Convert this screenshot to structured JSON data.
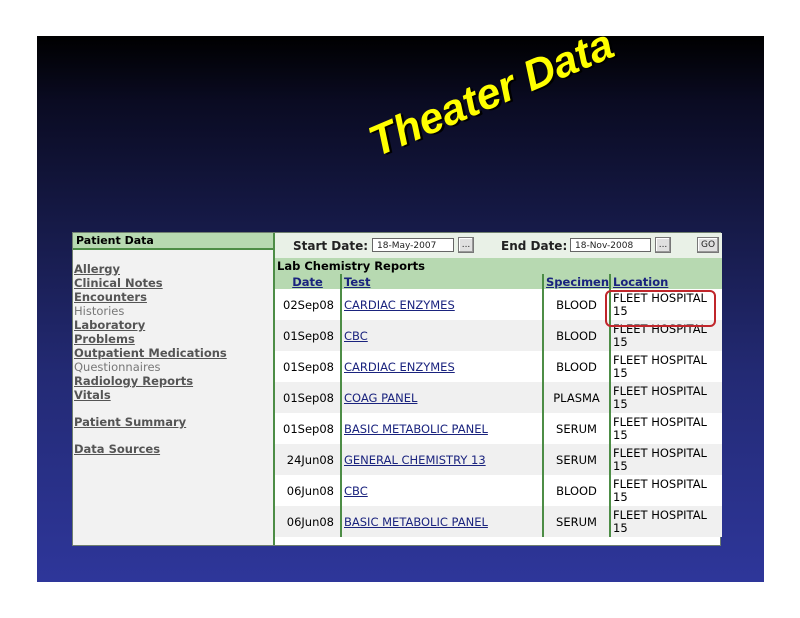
{
  "slide": {
    "title": "Theater Data"
  },
  "sidebar": {
    "header": "Patient Data",
    "items": [
      {
        "label": "Allergy",
        "style": "link"
      },
      {
        "label": "Clinical Notes",
        "style": "link"
      },
      {
        "label": "Encounters",
        "style": "link"
      },
      {
        "label": "Histories",
        "style": "plain"
      },
      {
        "label": "Laboratory",
        "style": "link"
      },
      {
        "label": "Problems",
        "style": "link"
      },
      {
        "label": "Outpatient Medications",
        "style": "link"
      },
      {
        "label": "Questionnaires",
        "style": "plain"
      },
      {
        "label": "Radiology Reports",
        "style": "link"
      },
      {
        "label": "Vitals",
        "style": "link"
      },
      {
        "label": "Patient Summary",
        "style": "link"
      },
      {
        "label": "Data Sources",
        "style": "link"
      }
    ]
  },
  "datebar": {
    "start_label": "Start Date:",
    "start_value": "18-May-2007",
    "end_label": "End Date:",
    "end_value": "18-Nov-2008",
    "picker_label": "...",
    "go_label": "GO"
  },
  "report": {
    "title": "Lab Chemistry Reports",
    "columns": [
      "Date",
      "Test",
      "Specimen",
      "Location"
    ],
    "rows": [
      {
        "date": "02Sep08",
        "test": "CARDIAC ENZYMES",
        "specimen": "BLOOD",
        "location_line1": "FLEET HOSPITAL",
        "location_line2": "15"
      },
      {
        "date": "01Sep08",
        "test": "CBC",
        "specimen": "BLOOD",
        "location_line1": "FLEET HOSPITAL",
        "location_line2": "15"
      },
      {
        "date": "01Sep08",
        "test": "CARDIAC ENZYMES",
        "specimen": "BLOOD",
        "location_line1": "FLEET HOSPITAL",
        "location_line2": "15"
      },
      {
        "date": "01Sep08",
        "test": "COAG PANEL",
        "specimen": "PLASMA",
        "location_line1": "FLEET HOSPITAL",
        "location_line2": "15"
      },
      {
        "date": "01Sep08",
        "test": "BASIC METABOLIC PANEL",
        "specimen": "SERUM",
        "location_line1": "FLEET HOSPITAL",
        "location_line2": "15"
      },
      {
        "date": "24Jun08",
        "test": "GENERAL CHEMISTRY 13",
        "specimen": "SERUM",
        "location_line1": "FLEET HOSPITAL",
        "location_line2": "15"
      },
      {
        "date": "06Jun08",
        "test": "CBC",
        "specimen": "BLOOD",
        "location_line1": "FLEET HOSPITAL",
        "location_line2": "15"
      },
      {
        "date": "06Jun08",
        "test": "BASIC METABOLIC PANEL",
        "specimen": "SERUM",
        "location_line1": "FLEET HOSPITAL",
        "location_line2": "15"
      }
    ]
  },
  "colors": {
    "title": "#ffff00",
    "header_green": "#b7d9b1",
    "divider_green": "#4d8d46",
    "link": "#1a237e",
    "highlight": "#c0262b"
  }
}
